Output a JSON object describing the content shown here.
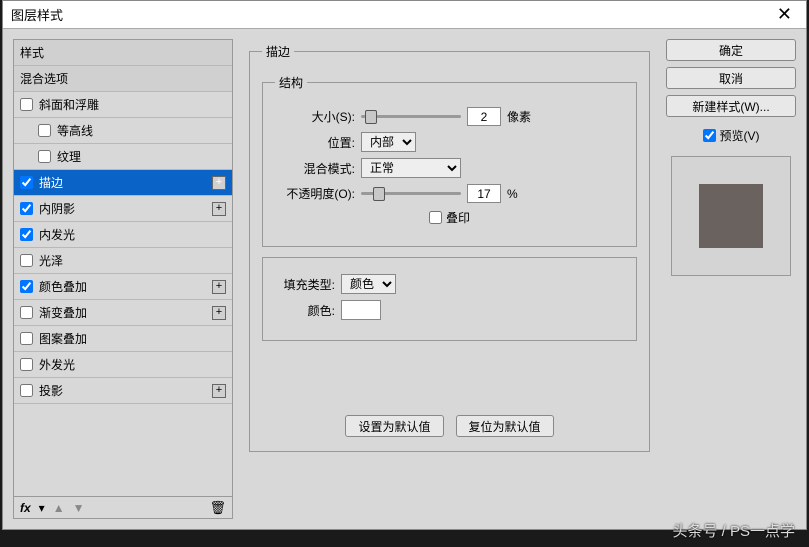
{
  "titlebar": {
    "title": "图层样式",
    "close": "✕"
  },
  "styleList": {
    "headerStyles": "样式",
    "blendOptions": "混合选项",
    "items": [
      {
        "label": "斜面和浮雕",
        "checked": false,
        "plus": false
      },
      {
        "label": "等高线",
        "checked": false,
        "child": true
      },
      {
        "label": "纹理",
        "checked": false,
        "child": true
      },
      {
        "label": "描边",
        "checked": true,
        "plus": true,
        "selected": true
      },
      {
        "label": "内阴影",
        "checked": true,
        "plus": true
      },
      {
        "label": "内发光",
        "checked": true
      },
      {
        "label": "光泽",
        "checked": false
      },
      {
        "label": "颜色叠加",
        "checked": true,
        "plus": true
      },
      {
        "label": "渐变叠加",
        "checked": false,
        "plus": true
      },
      {
        "label": "图案叠加",
        "checked": false
      },
      {
        "label": "外发光",
        "checked": false
      },
      {
        "label": "投影",
        "checked": false,
        "plus": true
      }
    ],
    "footer": {
      "fx": "fx",
      "up": "▲",
      "down": "▼",
      "trash": "🗑"
    }
  },
  "stroke": {
    "groupTitle": "描边",
    "structTitle": "结构",
    "sizeLabel": "大小(S):",
    "sizeValue": "2",
    "sizeUnit": "像素",
    "positionLabel": "位置:",
    "positionValue": "内部",
    "blendLabel": "混合模式:",
    "blendValue": "正常",
    "opacityLabel": "不透明度(O):",
    "opacityValue": "17",
    "opacityUnit": "%",
    "overprintLabel": "叠印",
    "fillTypeLabel": "填充类型:",
    "fillTypeValue": "颜色",
    "colorLabel": "颜色:",
    "defaultsBtn": "设置为默认值",
    "resetBtn": "复位为默认值"
  },
  "right": {
    "ok": "确定",
    "cancel": "取消",
    "newStyle": "新建样式(W)...",
    "preview": "预览(V)"
  },
  "watermark": "头条号 / PS一点学"
}
